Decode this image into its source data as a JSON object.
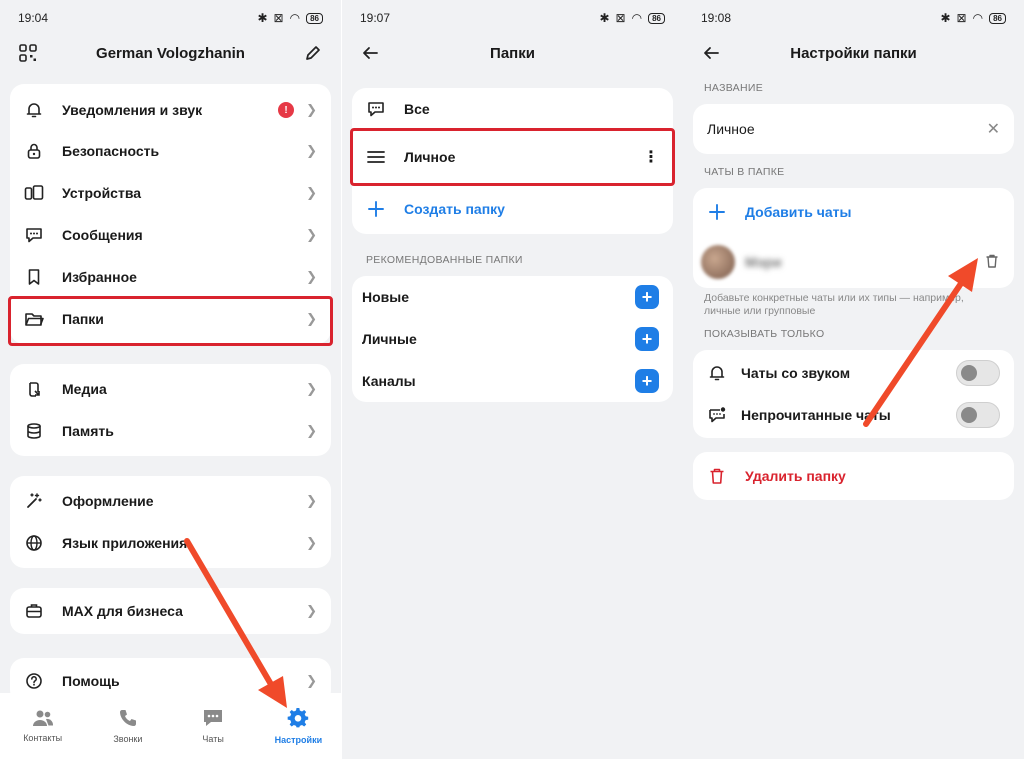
{
  "screen1": {
    "time": "19:04",
    "battery": "86",
    "title": "German Vologzhanin",
    "notif_badge": "!",
    "group1": [
      {
        "label": "Уведомления и звук"
      },
      {
        "label": "Безопасность"
      },
      {
        "label": "Устройства"
      },
      {
        "label": "Сообщения"
      },
      {
        "label": "Избранное"
      },
      {
        "label": "Папки"
      }
    ],
    "group2": [
      {
        "label": "Медиа"
      },
      {
        "label": "Память"
      }
    ],
    "group3": [
      {
        "label": "Оформление"
      },
      {
        "label": "Язык приложения"
      }
    ],
    "group4": [
      {
        "label": "MAX для бизнеса"
      }
    ],
    "group5": [
      {
        "label": "Помощь"
      }
    ],
    "tabs": [
      {
        "label": "Контакты"
      },
      {
        "label": "Звонки"
      },
      {
        "label": "Чаты"
      },
      {
        "label": "Настройки"
      }
    ]
  },
  "screen2": {
    "time": "19:07",
    "battery": "86",
    "title": "Папки",
    "folders": [
      {
        "label": "Все"
      },
      {
        "label": "Личное"
      }
    ],
    "create_label": "Создать папку",
    "recommended_title": "РЕКОМЕНДОВАННЫЕ ПАПКИ",
    "recommended": [
      {
        "label": "Новые"
      },
      {
        "label": "Личные"
      },
      {
        "label": "Каналы"
      }
    ]
  },
  "screen3": {
    "time": "19:08",
    "battery": "86",
    "title": "Настройки папки",
    "name_section": "НАЗВАНИЕ",
    "name_value": "Личное",
    "chats_section": "ЧАТЫ В ПАПКЕ",
    "add_chats": "Добавить чаты",
    "chat_name": "Мэри",
    "hint": "Добавьте конкретные чаты или их типы — например, личные или групповые",
    "show_only_section": "ПОКАЗЫВАТЬ ТОЛЬКО",
    "filters": [
      {
        "label": "Чаты со звуком"
      },
      {
        "label": "Непрочитанные чаты"
      }
    ],
    "delete_label": "Удалить папку"
  },
  "colors": {
    "accent": "#1f7ee6",
    "highlight": "#d9232e",
    "arrow": "#f04a2a",
    "background": "#f1f2f4"
  }
}
